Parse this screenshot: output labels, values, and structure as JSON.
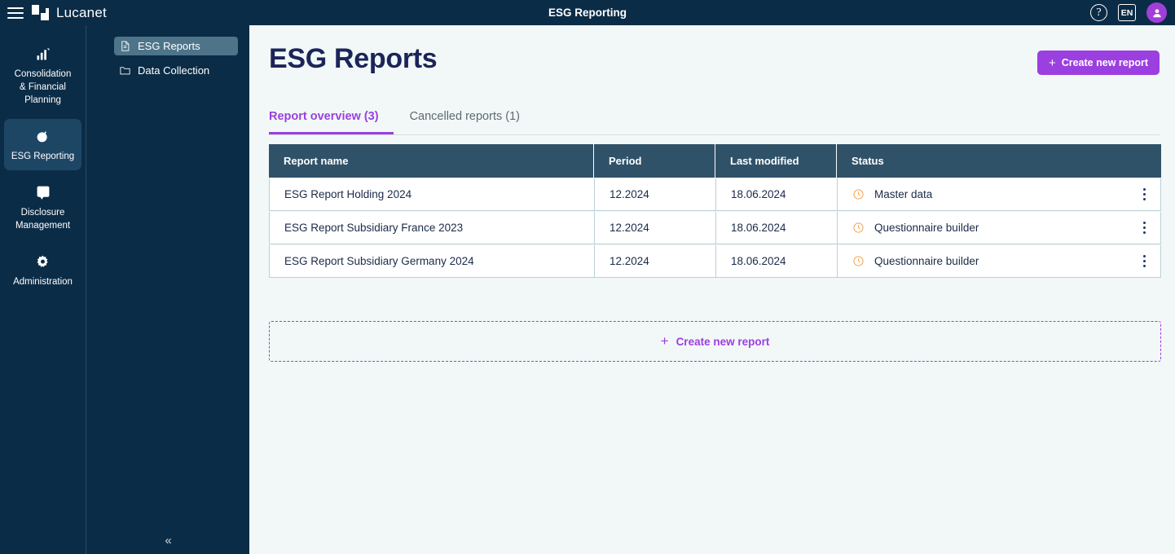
{
  "topbar": {
    "menu_icon": "hamburger-icon",
    "brand": "Lucanet",
    "title": "ESG Reporting",
    "help_glyph": "?",
    "language": "EN",
    "avatar_icon": "user-avatar-icon"
  },
  "rail": {
    "items": [
      {
        "label": "Consolidation\n& Financial\nPlanning",
        "icon": "bar-chart-icon",
        "active": false
      },
      {
        "label": "ESG Reporting",
        "icon": "leaf-check-icon",
        "active": true
      },
      {
        "label": "Disclosure\nManagement",
        "icon": "document-star-icon",
        "active": false
      },
      {
        "label": "Administration",
        "icon": "gear-icon",
        "active": false
      }
    ]
  },
  "tree": {
    "items": [
      {
        "label": "ESG Reports",
        "icon": "file-icon",
        "selected": true
      },
      {
        "label": "Data Collection",
        "icon": "folder-icon",
        "selected": false
      }
    ],
    "collapse_glyph": "«"
  },
  "main": {
    "page_title": "ESG Reports",
    "create_button": {
      "plus": "+",
      "label": "Create new report"
    },
    "tabs": [
      {
        "label": "Report overview (3)",
        "active": true
      },
      {
        "label": "Cancelled reports (1)",
        "active": false
      }
    ],
    "table": {
      "columns": [
        "Report name",
        "Period",
        "Last modified",
        "Status"
      ],
      "rows": [
        {
          "name": "ESG Report Holding 2024",
          "period": "12.2024",
          "modified": "18.06.2024",
          "status": "Master data",
          "status_icon": "clock-icon",
          "menu_icon": "kebab-menu-icon"
        },
        {
          "name": "ESG Report Subsidiary France 2023",
          "period": "12.2024",
          "modified": "18.06.2024",
          "status": "Questionnaire builder",
          "status_icon": "clock-icon",
          "menu_icon": "kebab-menu-icon"
        },
        {
          "name": "ESG Report Subsidiary Germany 2024",
          "period": "12.2024",
          "modified": "18.06.2024",
          "status": "Questionnaire builder",
          "status_icon": "clock-icon",
          "menu_icon": "kebab-menu-icon"
        }
      ]
    },
    "create_zone": {
      "plus": "+",
      "label": "Create new report"
    }
  },
  "colors": {
    "navy": "#0b2c47",
    "purple": "#9b3fe0",
    "table_header": "#2f5269",
    "status_orange": "#f09a3e",
    "page_bg": "#f2f8f7",
    "title_navy": "#1b2559"
  }
}
